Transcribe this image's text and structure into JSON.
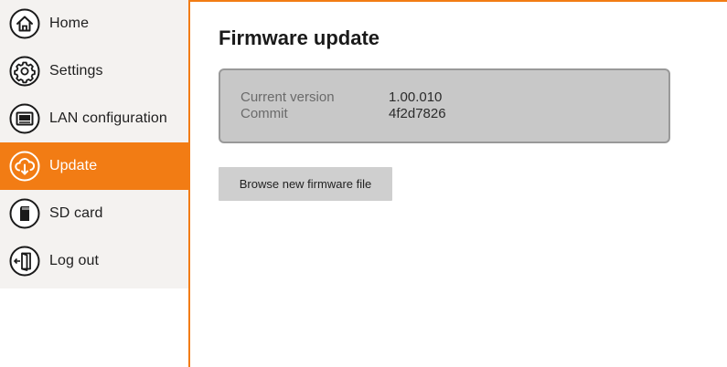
{
  "sidebar": {
    "items": [
      {
        "label": "Home",
        "icon": "home-icon"
      },
      {
        "label": "Settings",
        "icon": "gear-icon"
      },
      {
        "label": "LAN configuration",
        "icon": "lan-icon"
      },
      {
        "label": "Update",
        "icon": "cloud-update-icon",
        "active": true
      },
      {
        "label": "SD card",
        "icon": "sd-card-icon"
      },
      {
        "label": "Log out",
        "icon": "logout-icon"
      }
    ]
  },
  "main": {
    "title": "Firmware update",
    "version_info": {
      "current_version_label": "Current version",
      "current_version_value": "1.00.010",
      "commit_label": "Commit",
      "commit_value": "4f2d7826"
    },
    "browse_button_label": "Browse new firmware file"
  },
  "colors": {
    "accent": "#f27c14",
    "sidebar_bg": "#f4f2f0",
    "info_box_bg": "#c8c8c8",
    "button_bg": "#cfcfcf"
  }
}
